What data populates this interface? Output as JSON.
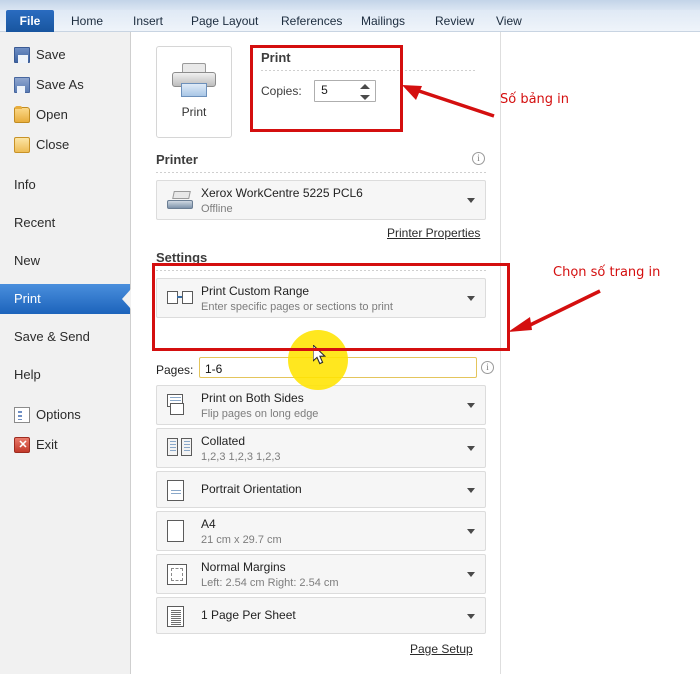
{
  "app": {
    "ribbon_tabs": [
      {
        "label": "File",
        "active": true
      },
      {
        "label": "Home",
        "active": false
      },
      {
        "label": "Insert",
        "active": false
      },
      {
        "label": "Page Layout",
        "active": false
      },
      {
        "label": "References",
        "active": false
      },
      {
        "label": "Mailings",
        "active": false
      },
      {
        "label": "Review",
        "active": false
      },
      {
        "label": "View",
        "active": false
      }
    ]
  },
  "sidebar": {
    "items": [
      {
        "label": "Save",
        "icon": "save-icon"
      },
      {
        "label": "Save As",
        "icon": "save-as-icon"
      },
      {
        "label": "Open",
        "icon": "open-folder-icon"
      },
      {
        "label": "Close",
        "icon": "close-folder-icon"
      },
      {
        "label": "Info",
        "icon": ""
      },
      {
        "label": "Recent",
        "icon": ""
      },
      {
        "label": "New",
        "icon": ""
      },
      {
        "label": "Print",
        "icon": "",
        "selected": true
      },
      {
        "label": "Save & Send",
        "icon": ""
      },
      {
        "label": "Help",
        "icon": ""
      },
      {
        "label": "Options",
        "icon": "options-icon"
      },
      {
        "label": "Exit",
        "icon": "exit-icon"
      }
    ]
  },
  "print": {
    "button_label": "Print",
    "heading": "Print",
    "copies_label": "Copies:",
    "copies_value": "5"
  },
  "printer": {
    "heading": "Printer",
    "name": "Xerox WorkCentre 5225 PCL6",
    "status": "Offline",
    "properties_link": "Printer Properties"
  },
  "settings": {
    "heading": "Settings",
    "page_setup_link": "Page Setup",
    "pages_label": "Pages:",
    "pages_value": "1-6",
    "rows": [
      {
        "title": "Print Custom Range",
        "subtitle": "Enter specific pages or sections to print",
        "icon": "page-range-icon"
      },
      {
        "title": "Print on Both Sides",
        "subtitle": "Flip pages on long edge",
        "icon": "duplex-icon"
      },
      {
        "title": "Collated",
        "subtitle": "1,2,3   1,2,3   1,2,3",
        "icon": "collate-icon"
      },
      {
        "title": "Portrait Orientation",
        "subtitle": "",
        "icon": "orientation-icon"
      },
      {
        "title": "A4",
        "subtitle": "21 cm x 29.7 cm",
        "icon": "paper-size-icon"
      },
      {
        "title": "Normal Margins",
        "subtitle": "Left:  2.54 cm    Right:  2.54 cm",
        "icon": "margins-icon"
      },
      {
        "title": "1 Page Per Sheet",
        "subtitle": "",
        "icon": "pages-per-sheet-icon"
      }
    ]
  },
  "annotations": {
    "color": "#d40f0f",
    "note_copies": "Số bảng in",
    "note_pages": "Chọn số trang in"
  }
}
